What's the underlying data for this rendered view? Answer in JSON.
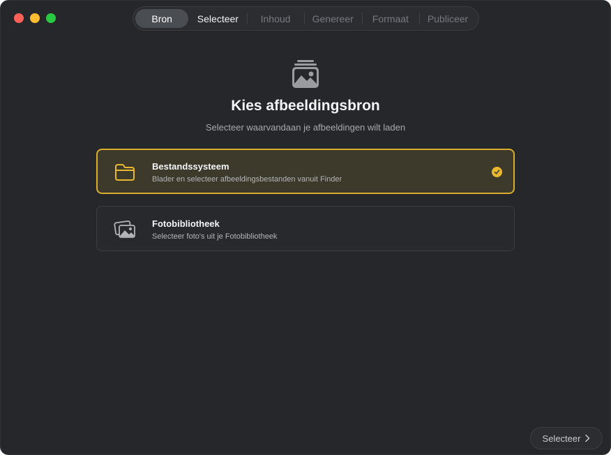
{
  "steps": [
    {
      "label": "Bron",
      "state": "active"
    },
    {
      "label": "Selecteer",
      "state": "next"
    },
    {
      "label": "Inhoud",
      "state": "disabled"
    },
    {
      "label": "Genereer",
      "state": "disabled"
    },
    {
      "label": "Formaat",
      "state": "disabled"
    },
    {
      "label": "Publiceer",
      "state": "disabled"
    }
  ],
  "header": {
    "icon": "photo-stack-icon",
    "title": "Kies afbeeldingsbron",
    "subtitle": "Selecteer waarvandaan je afbeeldingen wilt laden"
  },
  "options": [
    {
      "icon": "folder-icon",
      "title": "Bestandssysteem",
      "description": "Blader en selecteer afbeeldingsbestanden vanuit Finder",
      "selected": true
    },
    {
      "icon": "photo-library-icon",
      "title": "Fotobibliotheek",
      "description": "Selecteer foto's uit je Fotobibliotheek",
      "selected": false
    }
  ],
  "footer": {
    "next_label": "Selecteer",
    "next_icon": "chevron-right-icon"
  },
  "colors": {
    "accent": "#e8b92f",
    "window_bg": "#25272b",
    "selected_card_bg": "#3d3a2c"
  }
}
